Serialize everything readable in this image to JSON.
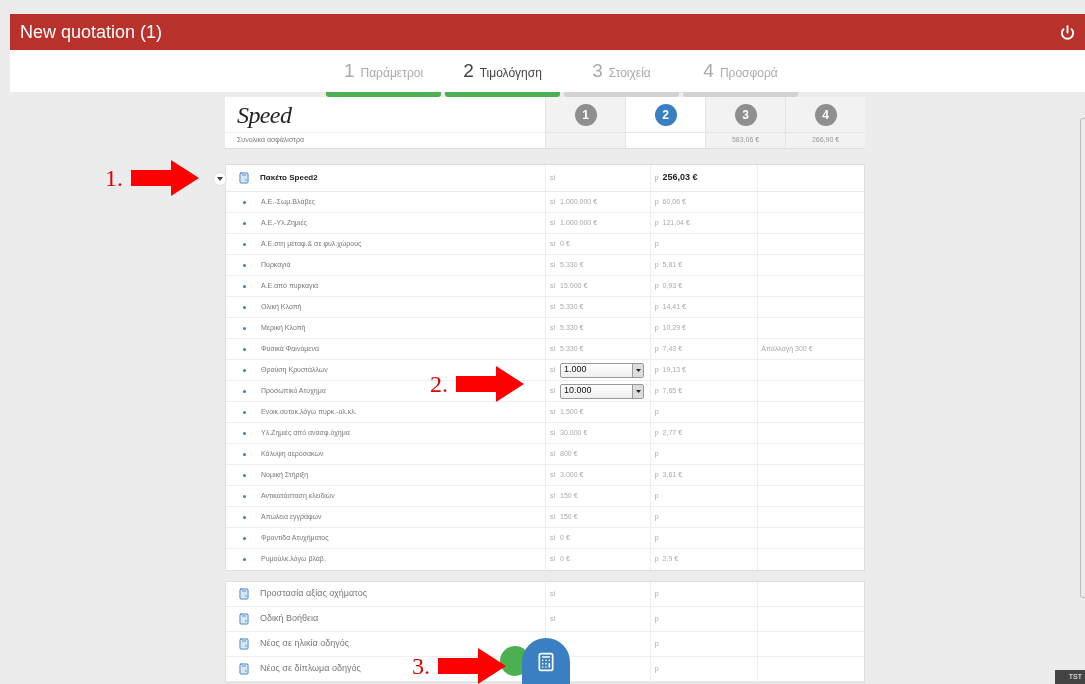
{
  "window": {
    "title": "New quotation (1)"
  },
  "steps": [
    {
      "number": "1",
      "label": "Παράμετροι",
      "selected": false,
      "done": true
    },
    {
      "number": "2",
      "label": "Τιμολόγηση",
      "selected": true,
      "done": true
    },
    {
      "number": "3",
      "label": "Στοιχεία",
      "selected": false,
      "done": false
    },
    {
      "number": "4",
      "label": "Προσφορά",
      "selected": false,
      "done": false
    }
  ],
  "price_header": {
    "logo": "Speed",
    "total_label": "Συνολικά ασφάλιστρα",
    "columns": [
      {
        "number": "1",
        "selected": false
      },
      {
        "number": "2",
        "selected": true
      },
      {
        "number": "3",
        "selected": false,
        "total": "583,06 €"
      },
      {
        "number": "4",
        "selected": false,
        "total": "266,90 €"
      }
    ]
  },
  "package": {
    "title": "Πακέτο Speed2",
    "expanded": true,
    "si": "si",
    "p": "p",
    "price": "256,03 €",
    "rows": [
      {
        "kind": "item",
        "name": "Α.Ε.-Σωμ.Βλάβες",
        "si": "si",
        "insured": "1.000.000 €",
        "p": "p",
        "premium": "60,06 €"
      },
      {
        "kind": "item",
        "name": "Α.Ε.-Υλ.Ζημιές",
        "si": "si",
        "insured": "1.000.000 €",
        "p": "p",
        "premium": "121,04 €"
      },
      {
        "kind": "item",
        "name": "Α.Ε.στη μεταφ.& σε φυλ.χώρους",
        "si": "si",
        "insured": "0 €",
        "p": "p"
      },
      {
        "kind": "item",
        "name": "Πυρκαγιά",
        "si": "si",
        "insured": "5.330 €",
        "p": "p",
        "premium": "5,81 €"
      },
      {
        "kind": "item",
        "name": "Α.Ε.από πυρκαγιά",
        "si": "si",
        "insured": "15.000 €",
        "p": "p",
        "premium": "0,93 €"
      },
      {
        "kind": "item",
        "name": "Ολική Κλοπή",
        "si": "si",
        "insured": "5.330 €",
        "p": "p",
        "premium": "14,41 €"
      },
      {
        "kind": "item",
        "name": "Μερική Κλοπή",
        "si": "si",
        "insured": "5.330 €",
        "p": "p",
        "premium": "10,29 €"
      },
      {
        "kind": "item",
        "name": "Φυσικά Φαινόμενα",
        "si": "si",
        "insured": "5.330 €",
        "p": "p",
        "premium": "7,43 €",
        "note": "Απαλλαγή 300 €"
      },
      {
        "kind": "select",
        "name": "Θραύση Κρυστάλλων",
        "si": "si",
        "insured": "1.000",
        "p": "p",
        "premium": "19,13 €"
      },
      {
        "kind": "select",
        "name": "Προσωπικό Ατύχημα",
        "si": "si",
        "insured": "10.000",
        "p": "p",
        "premium": "7,65 €"
      },
      {
        "kind": "item",
        "name": "Ενοικ.αυτοκ.λόγω πυρκ.-ολ.κλ.",
        "si": "si",
        "insured": "1.500 €",
        "p": "p"
      },
      {
        "kind": "item",
        "name": "Υλ.Ζημιές από ανασφ.όχημα",
        "si": "si",
        "insured": "30.000 €",
        "p": "p",
        "premium": "2,77 €"
      },
      {
        "kind": "item",
        "name": "Κάλυψη αερόσακων",
        "si": "si",
        "insured": "800 €",
        "p": "p"
      },
      {
        "kind": "item",
        "name": "Νομική Στήριξη",
        "si": "si",
        "insured": "3.000 €",
        "p": "p",
        "premium": "3,61 €"
      },
      {
        "kind": "item",
        "name": "Αντικατάσταση κλειδιών",
        "si": "si",
        "insured": "150 €",
        "p": "p"
      },
      {
        "kind": "item",
        "name": "Απώλεια εγγράφων",
        "si": "si",
        "insured": "150 €",
        "p": "p"
      },
      {
        "kind": "item",
        "name": "Φροντίδα Ατυχήματος",
        "si": "si",
        "insured": "0 €",
        "p": "p"
      },
      {
        "kind": "item",
        "name": "Ρυμούλκ.λόγω βλάβ.",
        "si": "si",
        "insured": "0 €",
        "p": "p",
        "premium": "2,9 €"
      }
    ]
  },
  "extras": [
    {
      "name": "Προστασία αξίας οχήματος",
      "si": "si",
      "p": "p"
    },
    {
      "name": "Οδική Βοήθεια",
      "si": "si",
      "p": "p"
    },
    {
      "name": "Νέος σε ηλικία οδηγός",
      "p": "p"
    },
    {
      "name": "Νέος σε δίπλωμα οδηγός",
      "p": "p"
    }
  ],
  "annotations": [
    {
      "label": "1."
    },
    {
      "label": "2."
    },
    {
      "label": "3."
    }
  ],
  "badge": "TST"
}
